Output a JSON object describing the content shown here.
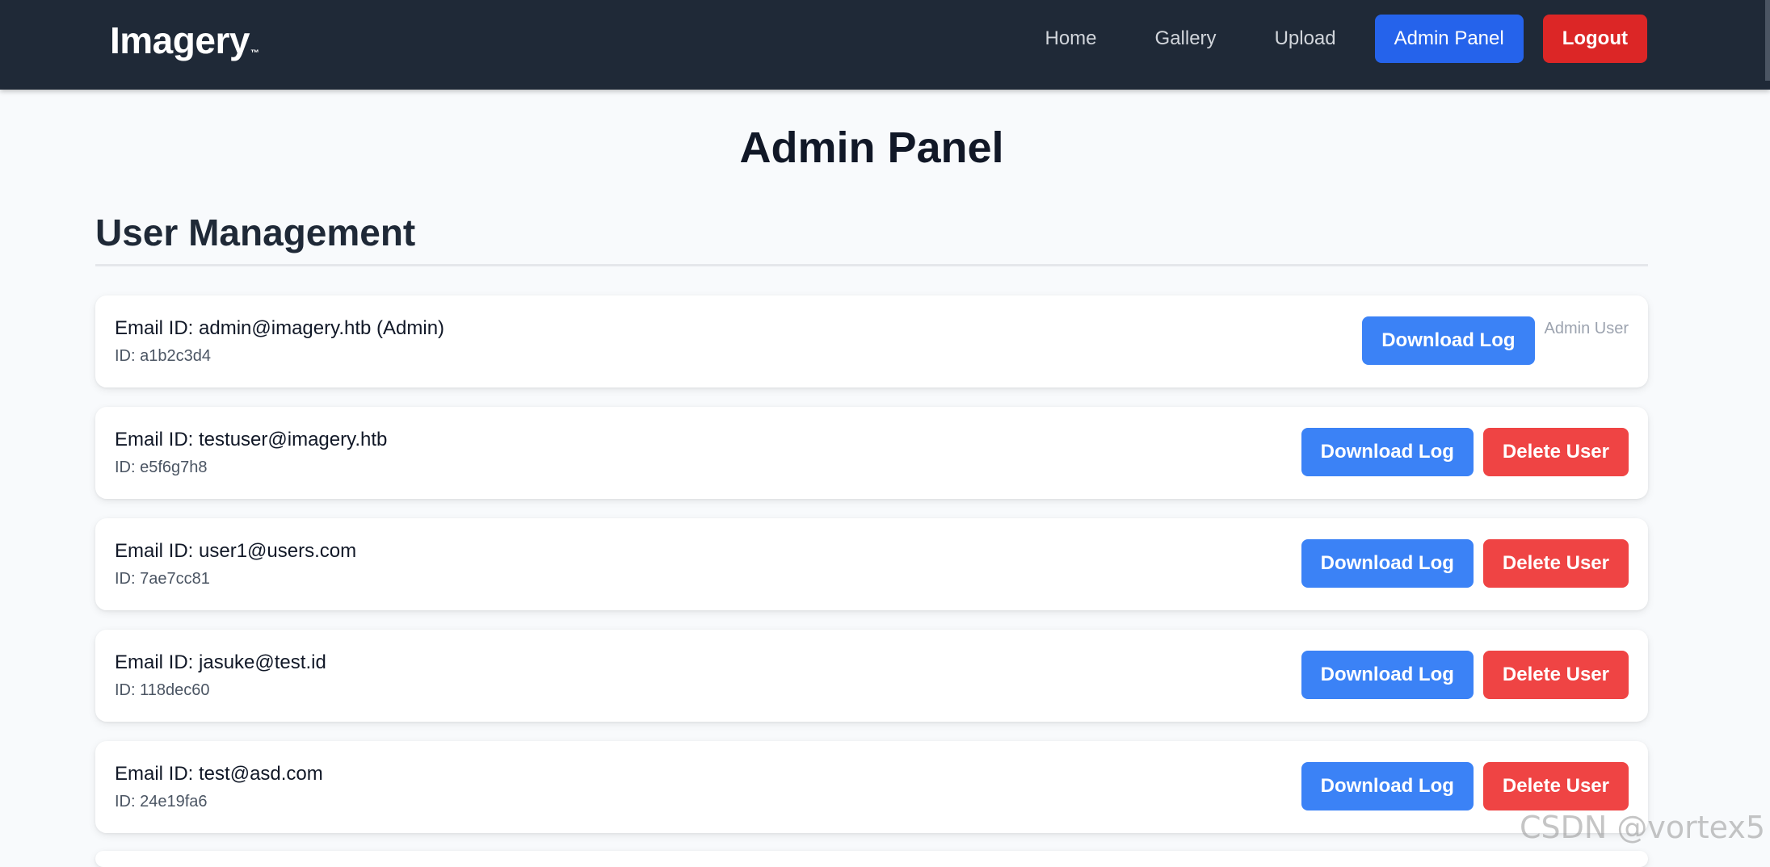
{
  "navbar": {
    "brand": "Imagery",
    "brand_mark": "™",
    "links": [
      "Home",
      "Gallery",
      "Upload"
    ],
    "admin_label": "Admin Panel",
    "logout_label": "Logout"
  },
  "page": {
    "title": "Admin Panel",
    "section_title": "User Management"
  },
  "users": [
    {
      "email": "Email ID: admin@imagery.htb (Admin)",
      "id": "ID: a1b2c3d4",
      "download_label": "Download Log",
      "secondary": "Admin User",
      "is_admin": true
    },
    {
      "email": "Email ID: testuser@imagery.htb",
      "id": "ID: e5f6g7h8",
      "download_label": "Download Log",
      "secondary": "Delete User",
      "is_admin": false
    },
    {
      "email": "Email ID: user1@users.com",
      "id": "ID: 7ae7cc81",
      "download_label": "Download Log",
      "secondary": "Delete User",
      "is_admin": false
    },
    {
      "email": "Email ID: jasuke@test.id",
      "id": "ID: 118dec60",
      "download_label": "Download Log",
      "secondary": "Delete User",
      "is_admin": false
    },
    {
      "email": "Email ID: test@asd.com",
      "id": "ID: 24e19fa6",
      "download_label": "Download Log",
      "secondary": "Delete User",
      "is_admin": false
    }
  ],
  "watermark": "CSDN @vortex5",
  "colors": {
    "navbar_bg": "#1f2937",
    "primary": "#3b82f6",
    "admin_button": "#2563eb",
    "danger": "#ef4444",
    "logout": "#dc2626"
  }
}
